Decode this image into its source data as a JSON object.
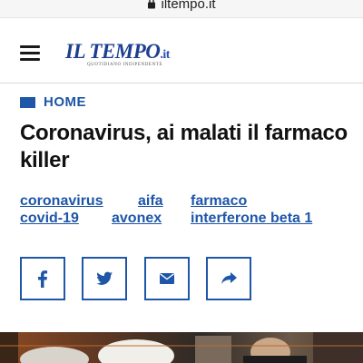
{
  "browser": {
    "url": "iltempo.it"
  },
  "header": {
    "logo_text": "IL TEMPO",
    "logo_suffix": ".it",
    "logo_tagline": "QUOTIDIANO INDIPENDENTE"
  },
  "breadcrumb": {
    "label": "HOME"
  },
  "article": {
    "headline": "Coronavirus, ai malati il farmaco killer",
    "tags": [
      "coronavirus",
      "aifa",
      "farmaco",
      "covid-19",
      "avonex",
      "interferone beta 1"
    ]
  },
  "share": {
    "buttons": [
      {
        "name": "facebook",
        "icon": "facebook-icon"
      },
      {
        "name": "twitter",
        "icon": "twitter-icon"
      },
      {
        "name": "email",
        "icon": "mail-icon"
      },
      {
        "name": "share",
        "icon": "share-arrow-icon"
      }
    ]
  },
  "colors": {
    "accent": "#1e56a8",
    "logo": "#1d3f8f",
    "headline": "#111111"
  }
}
